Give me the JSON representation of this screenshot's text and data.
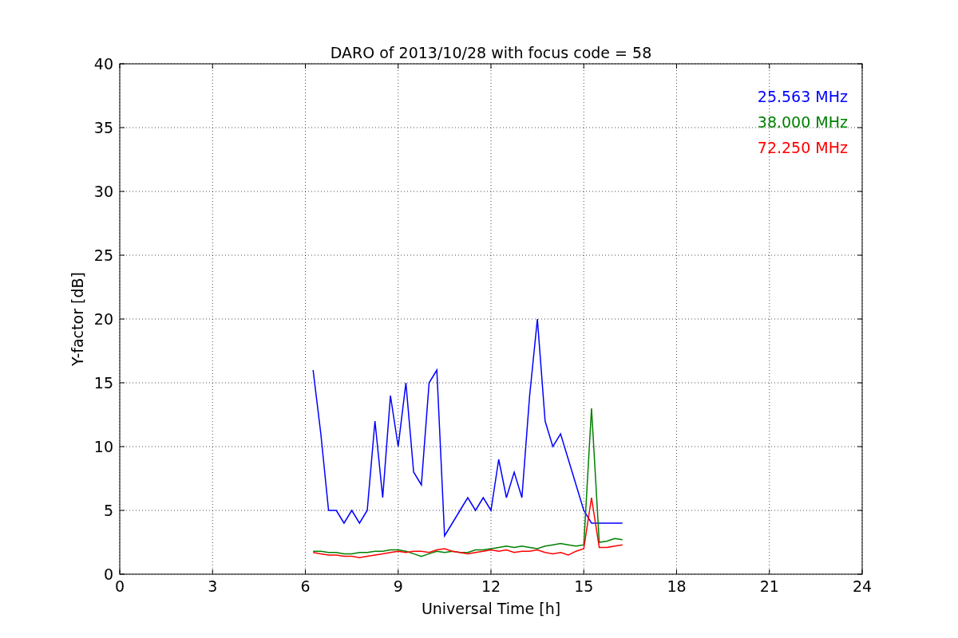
{
  "chart_data": {
    "type": "line",
    "title": "DARO of 2013/10/28 with focus code = 58",
    "xlabel": "Universal Time [h]",
    "ylabel": "Y-factor [dB]",
    "x": [
      6.25,
      6.5,
      6.75,
      7,
      7.25,
      7.5,
      7.75,
      8,
      8.25,
      8.5,
      8.75,
      9,
      9.25,
      9.5,
      9.75,
      10,
      10.25,
      10.5,
      10.75,
      11,
      11.25,
      11.5,
      11.75,
      12,
      12.25,
      12.5,
      12.75,
      13,
      13.25,
      13.5,
      13.75,
      14,
      14.25,
      14.5,
      14.75,
      15,
      15.25,
      15.5,
      15.75,
      16,
      16.25
    ],
    "series": [
      {
        "name": "25.563 MHz",
        "color": "#0000ff",
        "values": [
          16,
          11,
          5,
          5,
          4,
          5,
          4,
          5,
          12,
          6,
          14,
          10,
          15,
          8,
          7,
          15,
          16,
          3,
          4,
          5,
          6,
          5,
          6,
          5,
          9,
          6,
          8,
          6,
          14,
          20,
          12,
          10,
          11,
          9,
          7,
          5,
          4,
          4,
          4,
          4,
          4
        ]
      },
      {
        "name": "38.000 MHz",
        "color": "#008000",
        "values": [
          1.8,
          1.8,
          1.7,
          1.7,
          1.6,
          1.6,
          1.7,
          1.7,
          1.8,
          1.8,
          1.9,
          1.9,
          1.8,
          1.6,
          1.4,
          1.6,
          1.8,
          1.7,
          1.8,
          1.7,
          1.7,
          1.9,
          1.9,
          2,
          2.1,
          2.2,
          2.1,
          2.2,
          2.1,
          2,
          2.2,
          2.3,
          2.4,
          2.3,
          2.2,
          2.3,
          13,
          2.5,
          2.6,
          2.8,
          2.7
        ]
      },
      {
        "name": "72.250 MHz",
        "color": "#ff0000",
        "values": [
          1.7,
          1.6,
          1.5,
          1.5,
          1.4,
          1.4,
          1.3,
          1.4,
          1.5,
          1.6,
          1.7,
          1.8,
          1.7,
          1.8,
          1.8,
          1.7,
          1.9,
          2,
          1.8,
          1.7,
          1.6,
          1.7,
          1.8,
          1.9,
          1.8,
          1.9,
          1.7,
          1.8,
          1.8,
          1.9,
          1.7,
          1.6,
          1.7,
          1.5,
          1.8,
          2,
          6,
          2.1,
          2.1,
          2.2,
          2.3
        ]
      }
    ],
    "grid": true,
    "xlim": [
      0,
      24
    ],
    "ylim": [
      0,
      40
    ],
    "xticks": [
      0,
      3,
      6,
      9,
      12,
      15,
      18,
      21,
      24
    ],
    "yticks": [
      0,
      5,
      10,
      15,
      20,
      25,
      30,
      35,
      40
    ]
  }
}
